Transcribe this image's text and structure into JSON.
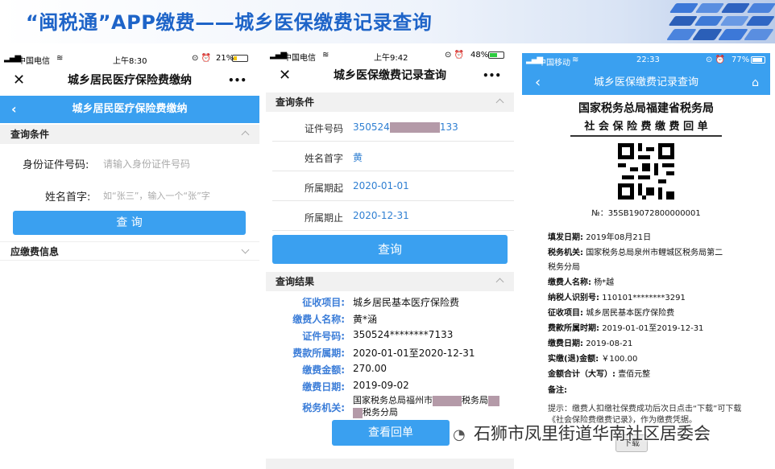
{
  "banner": {
    "title": "“闽税通”APP缴费——城乡医保缴费记录查询"
  },
  "watermark": {
    "text": "石狮市凤里街道华南社区居委会"
  },
  "colors": {
    "accent": "#2f80d8",
    "banner_title": "#1e64c8",
    "button": "#3aa0f0",
    "mask": "#b49aa8"
  },
  "phone1": {
    "status": {
      "carrier": "中国电信",
      "time": "上午8:30",
      "battery": "21%"
    },
    "title": "城乡居民医疗保险费缴纳",
    "more": "•••",
    "nav_title": "城乡居民医疗保险费缴纳",
    "query_section": "查询条件",
    "id_label": "身份证件号码:",
    "id_placeholder": "请输入身份证件号码",
    "name_label": "姓名首字:",
    "name_placeholder": "如“张三”，输入一个“张”字",
    "button": "查 询",
    "info_section": "应缴费信息"
  },
  "phone2": {
    "status": {
      "carrier": "中国电信",
      "time": "上午9:42",
      "battery": "48%"
    },
    "title": "城乡医保缴费记录查询",
    "more": "•••",
    "query_section": "查询条件",
    "fields": [
      {
        "label": "证件号码",
        "value_a": "350524",
        "value_b": "133"
      },
      {
        "label": "姓名首字",
        "value_a": "黄"
      },
      {
        "label": "所属期起",
        "value_a": "2020-01-01"
      },
      {
        "label": "所属期止",
        "value_a": "2020-12-31"
      }
    ],
    "button": "查询",
    "result_section": "查询结果",
    "results": [
      {
        "label": "征收项目:",
        "value": "城乡居民基本医疗保险费"
      },
      {
        "label": "缴费人名称:",
        "value": "黄*涵"
      },
      {
        "label": "证件号码:",
        "value": "350524********7133"
      },
      {
        "label": "费款所属期:",
        "value": "2020-01-01至2020-12-31"
      },
      {
        "label": "缴费金额:",
        "value": "270.00"
      },
      {
        "label": "缴费日期:",
        "value": "2019-09-02"
      },
      {
        "label": "税务机关:",
        "value_a": "国家税务总局福州市",
        "value_b": "税务局",
        "value_c": "税务分局"
      }
    ],
    "receipt_button": "查看回单"
  },
  "phone3": {
    "status": {
      "carrier": "中国移动",
      "time": "22:33",
      "battery": "77%"
    },
    "title": "城乡医保缴费记录查询",
    "receipt": {
      "org": "国家税务总局福建省税务局",
      "doc_title": "社 会 保 险 费 缴 费 回 单",
      "number": "№：35SB19072800000001",
      "lines": [
        {
          "label": "填发日期:",
          "value": "2019年08月21日"
        },
        {
          "label": "税务机关:",
          "value": "国家税务总局泉州市鲤城区税务局第二"
        },
        {
          "label": "",
          "value": "税务分局"
        },
        {
          "label": "缴费人名称:",
          "value": "杨*越"
        },
        {
          "label": "纳税人识别号:",
          "value": "110101********3291"
        },
        {
          "label": "征收项目:",
          "value": "城乡居民基本医疗保险费"
        },
        {
          "label": "费款所属时期:",
          "value": "2019-01-01至2019-12-31"
        },
        {
          "label": "缴费日期:",
          "value": "2019-08-21"
        },
        {
          "label": "实缴(退)金额:",
          "value": "￥100.00"
        },
        {
          "label": "金额合计（大写）:",
          "value": "壹佰元整"
        },
        {
          "label": "备注:",
          "value": ""
        }
      ],
      "note": "提示：缴费人扣缴社保费成功后次日点击“下载”可下载《社会保险费缴费记录》，作为缴费凭据。",
      "download": "下载"
    }
  }
}
